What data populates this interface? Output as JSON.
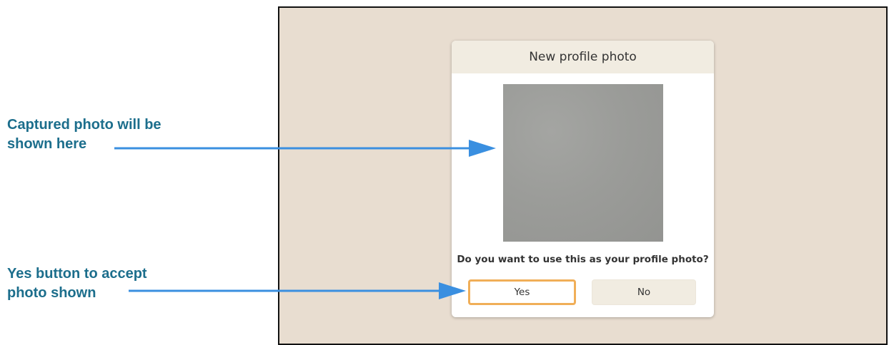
{
  "callouts": {
    "photo": {
      "line1": "Captured photo will be",
      "line2": "shown here"
    },
    "yes": {
      "line1": "Yes button to accept",
      "line2": "photo shown"
    }
  },
  "dialog": {
    "title": "New profile photo",
    "question": "Do you want to use this as your profile photo?",
    "yes_label": "Yes",
    "no_label": "No"
  },
  "colors": {
    "callout_text": "#1c6e8c",
    "arrow": "#3a8fe0",
    "screen_background": "#e8ddd0",
    "dialog_header": "#f1ece1",
    "yes_focus_border": "#f0ae58"
  }
}
